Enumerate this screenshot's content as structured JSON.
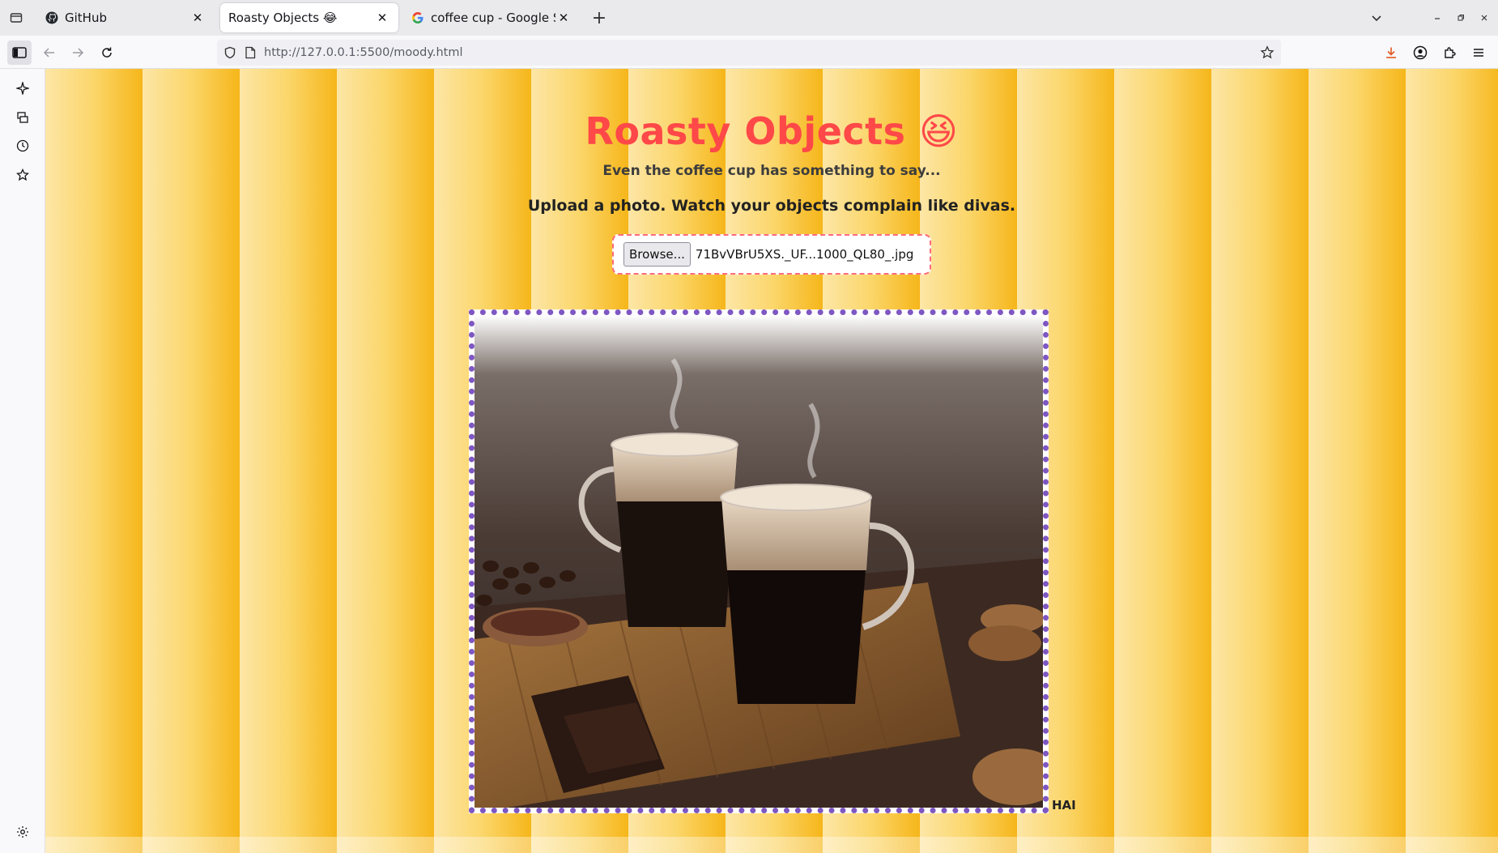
{
  "browser": {
    "tabs": [
      {
        "title": "GitHub",
        "icon": "github-icon",
        "active": false
      },
      {
        "title": "Roasty Objects 😂",
        "icon": "none",
        "active": true
      },
      {
        "title": "coffee cup - Google Search",
        "icon": "google-icon",
        "active": false
      }
    ],
    "url": "http://127.0.0.1:5500/moody.html"
  },
  "page": {
    "title": "Roasty Objects 😆",
    "subtitle": "Even the coffee cup has something to say...",
    "instructions": "Upload a photo. Watch your objects complain like divas.",
    "upload": {
      "button_label": "Browse...",
      "file_name": "71BvVBrU5XS._UF...1000_QL80_.jpg"
    },
    "caption": "HAI"
  },
  "colors": {
    "title": "#ff4848",
    "frame_border": "#7e57c2",
    "upload_border": "#ff6b7a",
    "stripe_light": "#fde6a6",
    "stripe_dark": "#f6b61a"
  }
}
